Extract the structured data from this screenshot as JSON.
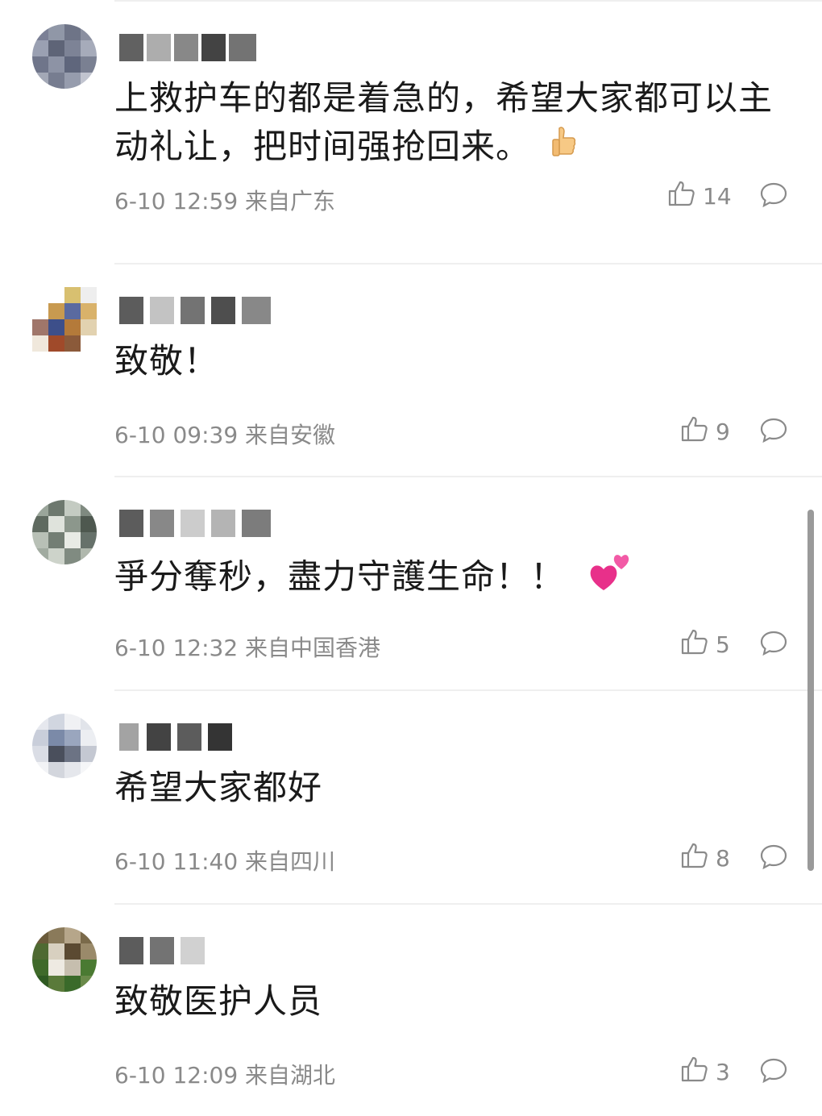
{
  "comments": [
    {
      "text_line1": "上救护车的都是着急的，希望大家都可以主",
      "text_line2": "动礼让，把时间强抢回来。",
      "emoji": "thumbs-up-emoji",
      "time": "6-10 12:59",
      "location": "来自广东",
      "likes": "14"
    },
    {
      "text_line1": "致敬！",
      "text_line2": "",
      "time": "6-10 09:39",
      "location": "来自安徽",
      "likes": "9"
    },
    {
      "text_line1": "爭分奪秒，盡力守護生命！！",
      "text_line2": "",
      "emoji": "two-hearts-emoji",
      "time": "6-10 12:32",
      "location": "来自中国香港",
      "likes": "5"
    },
    {
      "text_line1": "希望大家都好",
      "text_line2": "",
      "time": "6-10 11:40",
      "location": "来自四川",
      "likes": "8"
    },
    {
      "text_line1": "致敬医护人员",
      "text_line2": "",
      "time": "6-10 12:09",
      "location": "来自湖北",
      "likes": "3"
    }
  ],
  "icons": {
    "like": "thumbs-up-outline-icon",
    "reply": "speech-bubble-outline-icon"
  },
  "colors": {
    "meta_text": "#8a8a8a",
    "divider": "#efefef",
    "heart": "#e8308a"
  }
}
